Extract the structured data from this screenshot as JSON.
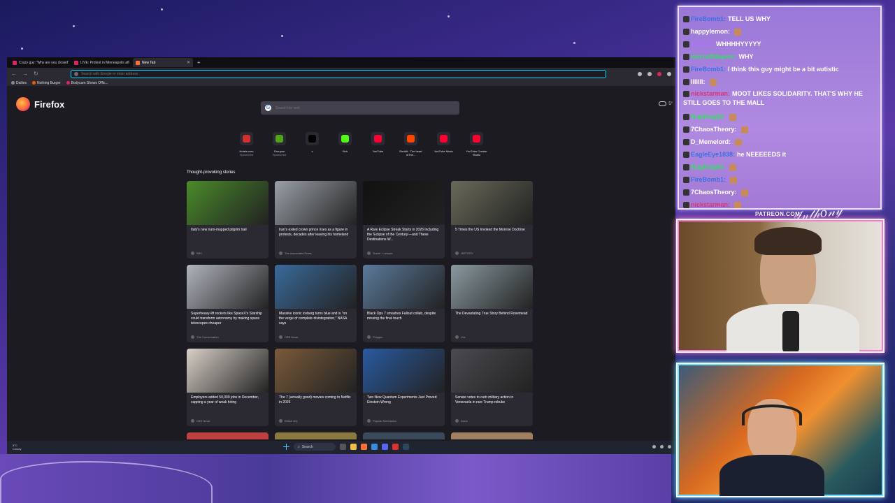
{
  "browser": {
    "tabs": [
      {
        "label": "Crazy guy: 'Why are you closed'"
      },
      {
        "label": "LIVE: Protest in Minneapolis aft"
      },
      {
        "label": "New Tab"
      }
    ],
    "url_placeholder": "Search with Google or enter address",
    "bookmarks": [
      "Dailies",
      "Nothing Burger",
      "Bodycam Shows Offic..."
    ]
  },
  "newtab": {
    "brand": "Firefox",
    "search_placeholder": "Search the web",
    "weather_temp": "5°",
    "shortcuts": [
      {
        "label": "Hotels.com",
        "sponsored": "Sponsored",
        "color": "#d32f2f"
      },
      {
        "label": "Groupon",
        "sponsored": "Sponsored",
        "color": "#53a318"
      },
      {
        "label": "x",
        "sponsored": "",
        "color": "#000000"
      },
      {
        "label": "Kick",
        "sponsored": "",
        "color": "#53fc18"
      },
      {
        "label": "YouTube",
        "sponsored": "",
        "color": "#ff0033"
      },
      {
        "label": "Reddit - The heart of the...",
        "sponsored": "",
        "color": "#ff4500"
      },
      {
        "label": "YouTube Music",
        "sponsored": "",
        "color": "#ff0033"
      },
      {
        "label": "YouTube Creator Studio",
        "sponsored": "",
        "color": "#ff0033"
      }
    ],
    "stories_title": "Thought-provoking stories",
    "stories": [
      {
        "title": "Italy's new num-mapped pilgrim trail",
        "source": "BBC",
        "color": "#4a8a2a"
      },
      {
        "title": "Iran's exiled crown prince rises as a figure in protests, decades after leaving his homeland",
        "source": "The Associated Press",
        "color": "#9aa0a8"
      },
      {
        "title": "A Rare Eclipse Streak Starts in 2026 Including the 'Eclipse of the Century'—and These Destinations W...",
        "source": "Travel + Leisure",
        "color": "#111111"
      },
      {
        "title": "5 Times the US Invoked the Monroe Doctrine",
        "source": "HISTORY",
        "color": "#6a6a5a"
      },
      {
        "title": "Superheavy-lift rockets like SpaceX's Starship could transform astronomy by making space telescopes cheaper",
        "source": "The Conversation",
        "color": "#b0b4bc"
      },
      {
        "title": "Massive iconic iceberg turns blue and is \"on the verge of complete disintegration,\" NASA says",
        "source": "CBS News",
        "color": "#3a6a9a"
      },
      {
        "title": "Black Ops 7 smashes Fallout collab, despite missing the final touch",
        "source": "Polygon",
        "color": "#5a7a9a"
      },
      {
        "title": "The Devastating True Story Behind Rosemead",
        "source": "Vox",
        "color": "#8a9aa0"
      },
      {
        "title": "Employers added 50,000 jobs in December, capping a year of weak hiring",
        "source": "CBS News",
        "color": "#d8d0c8"
      },
      {
        "title": "The 7 (actually good) movies coming to Netflix in 2026",
        "source": "British GQ",
        "color": "#7a5a3a"
      },
      {
        "title": "Two New Quantum Experiments Just Proved Einstein Wrong",
        "source": "Popular Mechanics",
        "color": "#2a5aa0"
      },
      {
        "title": "Senate votes to curb military action in Venezuela in rare Trump rebuke",
        "source": "Axios",
        "color": "#4a4a50"
      }
    ]
  },
  "taskbar": {
    "weather_temp": "8°C",
    "weather_desc": "Cloudy",
    "search_label": "Search"
  },
  "chat": {
    "messages": [
      {
        "user": "FireBomb1:",
        "text": "TELL US WHY",
        "color": "#3a70e0"
      },
      {
        "user": "happylemon:",
        "text": "",
        "color": "#ffffff"
      },
      {
        "user": "ZMJO2:",
        "text": "WHHHHYYYYY",
        "color": "#b070ff"
      },
      {
        "user": "mercoffdaperc:",
        "text": "WHY",
        "color": "#30e060"
      },
      {
        "user": "FireBomb1:",
        "text": "I think this guy might be a bit autistic",
        "color": "#3a70e0"
      },
      {
        "user": "lllllll:",
        "text": "",
        "color": "#ffffff"
      },
      {
        "user": "nickstarman:",
        "text": "MOOT LIKES SOLIDARITY. THAT'S WHY HE STILL GOES TO THE MALL",
        "color": "#e03070"
      },
      {
        "user": "NugKnight:",
        "text": "",
        "color": "#30e060"
      },
      {
        "user": "7ChaosTheory:",
        "text": "",
        "color": "#ffffff"
      },
      {
        "user": "D_Memelord:",
        "text": "",
        "color": "#ffffff"
      },
      {
        "user": "EagleEye1838:",
        "text": "he NEEEEEDS it",
        "color": "#3a70e0"
      },
      {
        "user": "NugKnight:",
        "text": "",
        "color": "#30e060"
      },
      {
        "user": "FireBomb1:",
        "text": "",
        "color": "#3a70e0"
      },
      {
        "user": "7ChaosTheory:",
        "text": "",
        "color": "#ffffff"
      },
      {
        "user": "nickstarman:",
        "text": "",
        "color": "#e03070"
      }
    ]
  },
  "overlay": {
    "patreon": "PATREON.COM/",
    "signature": "Anthony Sebe"
  }
}
